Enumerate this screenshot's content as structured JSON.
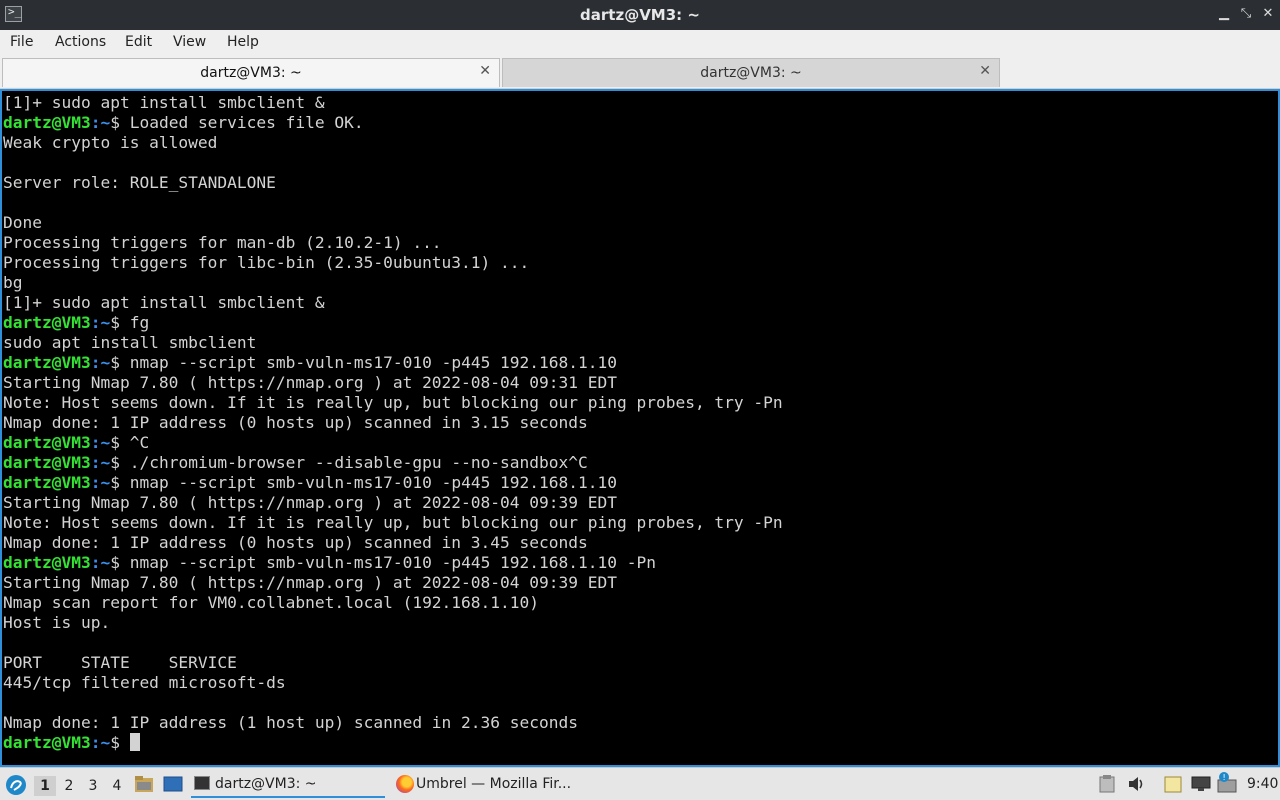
{
  "window": {
    "title": "dartz@VM3: ~",
    "app_icon_glyph": ">_",
    "minimize": "▁",
    "maximize": "⤡",
    "close": "✕"
  },
  "menu": [
    "File",
    "Actions",
    "Edit",
    "View",
    "Help"
  ],
  "tabs": [
    {
      "label": "dartz@VM3: ~",
      "active": true,
      "close": "✕"
    },
    {
      "label": "dartz@VM3: ~",
      "active": false,
      "close": "✕"
    }
  ],
  "terminal": {
    "prompt_user": "dartz@VM3",
    "prompt_path": ":~",
    "prompt_sign": "$ ",
    "lines": [
      {
        "text": "[1]+ sudo apt install smbclient &"
      },
      {
        "prompt": true,
        "text": "Loaded services file OK."
      },
      {
        "text": "Weak crypto is allowed"
      },
      {
        "text": ""
      },
      {
        "text": "Server role: ROLE_STANDALONE"
      },
      {
        "text": ""
      },
      {
        "text": "Done"
      },
      {
        "text": "Processing triggers for man-db (2.10.2-1) ..."
      },
      {
        "text": "Processing triggers for libc-bin (2.35-0ubuntu3.1) ..."
      },
      {
        "text": "bg"
      },
      {
        "text": "[1]+ sudo apt install smbclient &"
      },
      {
        "prompt": true,
        "text": "fg"
      },
      {
        "text": "sudo apt install smbclient"
      },
      {
        "prompt": true,
        "text": "nmap --script smb-vuln-ms17-010 -p445 192.168.1.10"
      },
      {
        "text": "Starting Nmap 7.80 ( https://nmap.org ) at 2022-08-04 09:31 EDT"
      },
      {
        "text": "Note: Host seems down. If it is really up, but blocking our ping probes, try -Pn"
      },
      {
        "text": "Nmap done: 1 IP address (0 hosts up) scanned in 3.15 seconds"
      },
      {
        "prompt": true,
        "text": "^C"
      },
      {
        "prompt": true,
        "text": "./chromium-browser --disable-gpu --no-sandbox^C"
      },
      {
        "prompt": true,
        "text": "nmap --script smb-vuln-ms17-010 -p445 192.168.1.10"
      },
      {
        "text": "Starting Nmap 7.80 ( https://nmap.org ) at 2022-08-04 09:39 EDT"
      },
      {
        "text": "Note: Host seems down. If it is really up, but blocking our ping probes, try -Pn"
      },
      {
        "text": "Nmap done: 1 IP address (0 hosts up) scanned in 3.45 seconds"
      },
      {
        "prompt": true,
        "text": "nmap --script smb-vuln-ms17-010 -p445 192.168.1.10 -Pn"
      },
      {
        "text": "Starting Nmap 7.80 ( https://nmap.org ) at 2022-08-04 09:39 EDT"
      },
      {
        "text": "Nmap scan report for VM0.collabnet.local (192.168.1.10)"
      },
      {
        "text": "Host is up."
      },
      {
        "text": ""
      },
      {
        "text": "PORT    STATE    SERVICE"
      },
      {
        "text": "445/tcp filtered microsoft-ds"
      },
      {
        "text": ""
      },
      {
        "text": "Nmap done: 1 IP address (1 host up) scanned in 2.36 seconds"
      },
      {
        "prompt": true,
        "text": "",
        "cursor": true
      }
    ]
  },
  "taskbar": {
    "workspaces": [
      "1",
      "2",
      "3",
      "4"
    ],
    "current_workspace": "1",
    "tasks": [
      {
        "label": "dartz@VM3: ~",
        "icon": "terminal-icon",
        "active": true
      },
      {
        "label": "Umbrel — Mozilla Fir...",
        "icon": "firefox-icon",
        "active": false
      }
    ],
    "clock": "9:40",
    "colors": {
      "accent": "#2f8fd8",
      "prompt_user": "#34e234",
      "prompt_path": "#3b8eea"
    }
  }
}
